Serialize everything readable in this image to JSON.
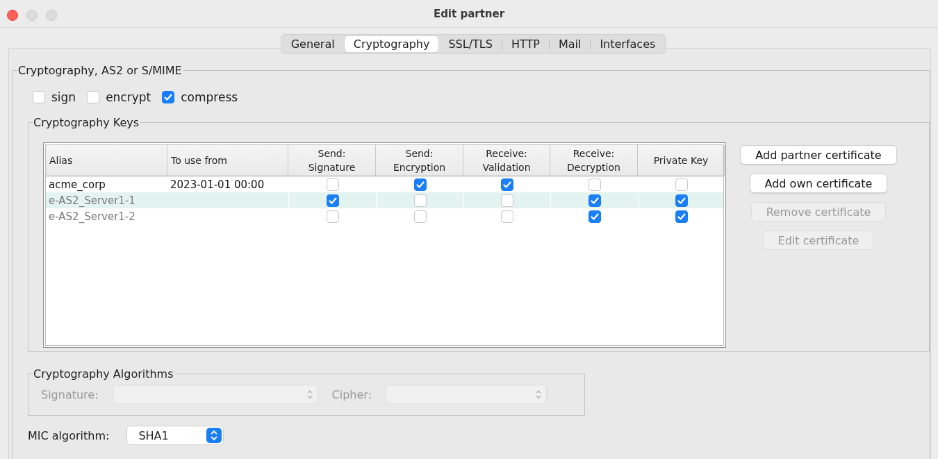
{
  "window": {
    "title": "Edit partner"
  },
  "tabs": [
    {
      "label": "General",
      "selected": false
    },
    {
      "label": "Cryptography",
      "selected": true
    },
    {
      "label": "SSL/TLS",
      "selected": false
    },
    {
      "label": "HTTP",
      "selected": false
    },
    {
      "label": "Mail",
      "selected": false
    },
    {
      "label": "Interfaces",
      "selected": false
    }
  ],
  "crypto_group": {
    "title": "Cryptography, AS2 or S/MIME",
    "options": [
      {
        "label": "sign",
        "checked": false
      },
      {
        "label": "encrypt",
        "checked": false
      },
      {
        "label": "compress",
        "checked": true
      }
    ],
    "keys": {
      "title": "Cryptography Keys",
      "table": {
        "columns": [
          "Alias",
          "To use from",
          "Send: Signature",
          "Send: Encryption",
          "Receive: Validation",
          "Receive: Decryption",
          "Private Key"
        ],
        "rows": [
          {
            "alias": "acme_corp",
            "use_from": "2023-01-01 00:00",
            "disabled": false,
            "selected": false,
            "checks": [
              false,
              true,
              true,
              false,
              false
            ]
          },
          {
            "alias": "e-AS2_Server1-1",
            "disabled": true,
            "selected": true,
            "checks": [
              true,
              false,
              false,
              true,
              true
            ]
          },
          {
            "alias": "e-AS2_Server1-2",
            "disabled": true,
            "selected": false,
            "checks": [
              false,
              false,
              false,
              true,
              true
            ]
          }
        ]
      },
      "buttons": [
        {
          "label": "Add partner certificate",
          "disabled": false
        },
        {
          "label": "Add own certificate",
          "disabled": false
        },
        {
          "label": "Remove certificate",
          "disabled": true
        },
        {
          "label": "Edit certificate",
          "disabled": true
        }
      ]
    },
    "algorithms": {
      "title": "Cryptography Algorithms",
      "fields": [
        {
          "label": "Signature:",
          "disabled": true
        },
        {
          "label": "Cipher:",
          "disabled": true
        }
      ]
    }
  },
  "mic_algorithm": {
    "label": "MIC algorithm:",
    "value": "SHA1",
    "disabled": false
  }
}
